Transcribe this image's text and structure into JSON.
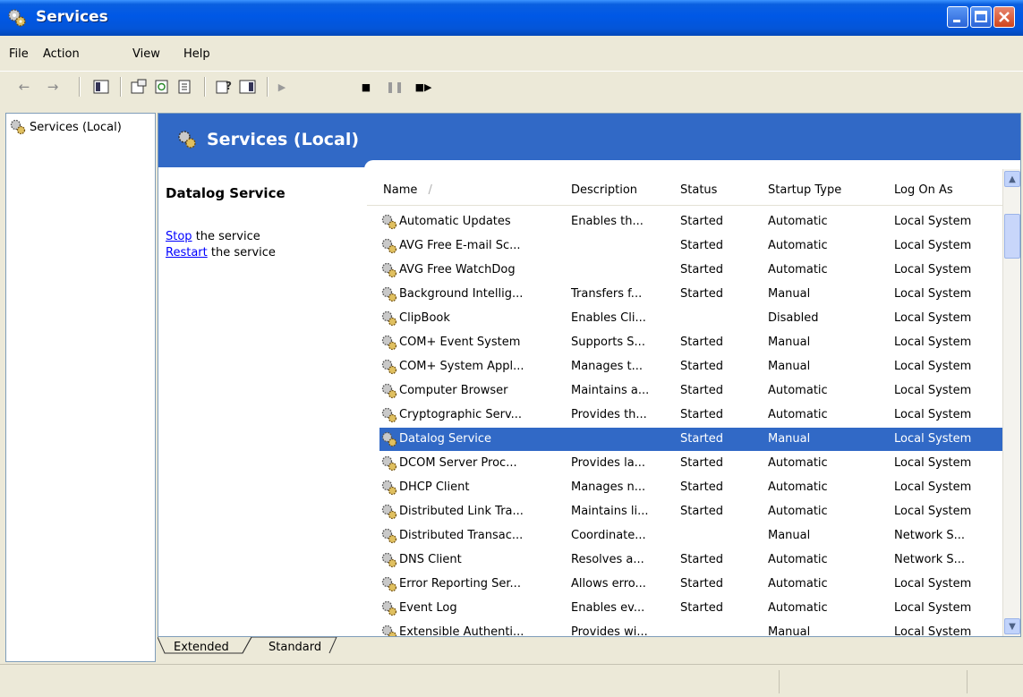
{
  "window": {
    "title": "Services"
  },
  "menu": [
    "File",
    "Action",
    "View",
    "Help"
  ],
  "tree": {
    "item": "Services (Local)"
  },
  "pane": {
    "title": "Services (Local)"
  },
  "details": {
    "service_name": "Datalog Service",
    "stop_link": "Stop",
    "stop_rest": " the service",
    "restart_link": "Restart",
    "restart_rest": " the service"
  },
  "columns": {
    "name": "Name",
    "sort_indicator": "/",
    "description": "Description",
    "status": "Status",
    "startup_type": "Startup Type",
    "log_on_as": "Log On As"
  },
  "rows": [
    {
      "name": "Automatic Updates",
      "description": "Enables th...",
      "status": "Started",
      "startup": "Automatic",
      "logon": "Local System"
    },
    {
      "name": "AVG Free E-mail Sc...",
      "description": "",
      "status": "Started",
      "startup": "Automatic",
      "logon": "Local System"
    },
    {
      "name": "AVG Free WatchDog",
      "description": "",
      "status": "Started",
      "startup": "Automatic",
      "logon": "Local System"
    },
    {
      "name": "Background Intellig...",
      "description": "Transfers f...",
      "status": "Started",
      "startup": "Manual",
      "logon": "Local System"
    },
    {
      "name": "ClipBook",
      "description": "Enables Cli...",
      "status": "",
      "startup": "Disabled",
      "logon": "Local System"
    },
    {
      "name": "COM+ Event System",
      "description": "Supports S...",
      "status": "Started",
      "startup": "Manual",
      "logon": "Local System"
    },
    {
      "name": "COM+ System Appl...",
      "description": "Manages t...",
      "status": "Started",
      "startup": "Manual",
      "logon": "Local System"
    },
    {
      "name": "Computer Browser",
      "description": "Maintains a...",
      "status": "Started",
      "startup": "Automatic",
      "logon": "Local System"
    },
    {
      "name": "Cryptographic Serv...",
      "description": "Provides th...",
      "status": "Started",
      "startup": "Automatic",
      "logon": "Local System"
    },
    {
      "name": "Datalog Service",
      "description": "",
      "status": "Started",
      "startup": "Manual",
      "logon": "Local System",
      "selected": true
    },
    {
      "name": "DCOM Server Proc...",
      "description": "Provides la...",
      "status": "Started",
      "startup": "Automatic",
      "logon": "Local System"
    },
    {
      "name": "DHCP Client",
      "description": "Manages n...",
      "status": "Started",
      "startup": "Automatic",
      "logon": "Local System"
    },
    {
      "name": "Distributed Link Tra...",
      "description": "Maintains li...",
      "status": "Started",
      "startup": "Automatic",
      "logon": "Local System"
    },
    {
      "name": "Distributed Transac...",
      "description": "Coordinate...",
      "status": "",
      "startup": "Manual",
      "logon": "Network S..."
    },
    {
      "name": "DNS Client",
      "description": "Resolves a...",
      "status": "Started",
      "startup": "Automatic",
      "logon": "Network S..."
    },
    {
      "name": "Error Reporting Ser...",
      "description": "Allows erro...",
      "status": "Started",
      "startup": "Automatic",
      "logon": "Local System"
    },
    {
      "name": "Event Log",
      "description": "Enables ev...",
      "status": "Started",
      "startup": "Automatic",
      "logon": "Local System"
    },
    {
      "name": "Extensible Authenti...",
      "description": "Provides wi...",
      "status": "",
      "startup": "Manual",
      "logon": "Local System"
    }
  ],
  "tabs": [
    "Extended",
    "Standard"
  ],
  "colors": {
    "title_blue": "#0058E6",
    "header_blue": "#3169C6",
    "selection": "#3169C6",
    "chrome": "#ECE9D8",
    "link": "#0000FF"
  },
  "icons": {
    "service": "gears-icon",
    "back": "back-arrow-icon",
    "forward": "forward-arrow-icon"
  }
}
